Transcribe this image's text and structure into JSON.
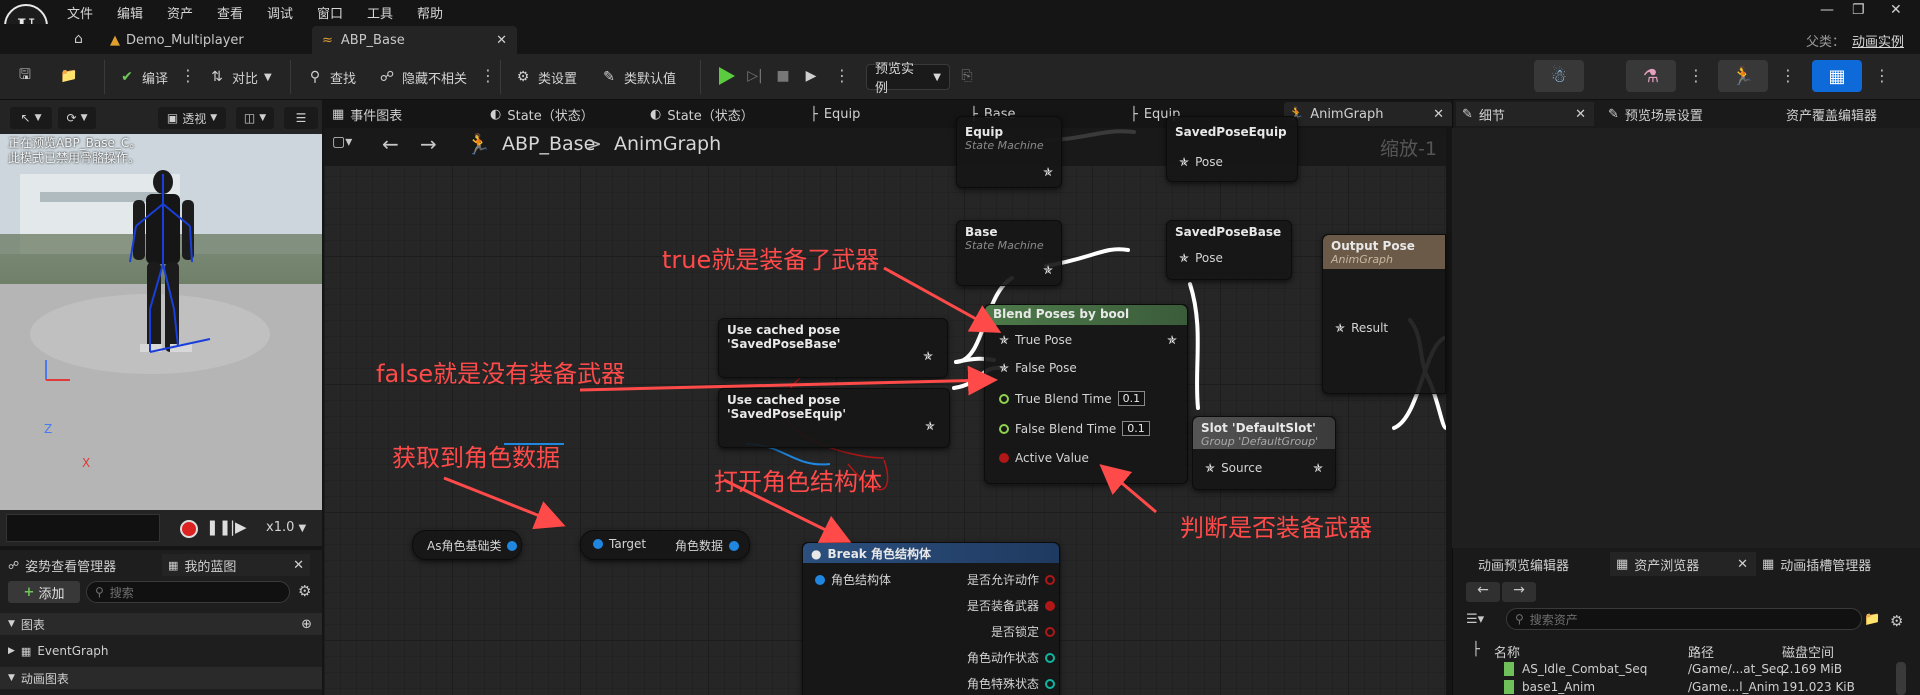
{
  "menu": {
    "items": [
      "文件",
      "编辑",
      "资产",
      "查看",
      "调试",
      "窗口",
      "工具",
      "帮助"
    ]
  },
  "tabs": {
    "project": "Demo_Multiplayer",
    "asset": "ABP_Base",
    "parent_label": "父类：",
    "parent_value": "动画实例"
  },
  "toolbar": {
    "compile": "编译",
    "diff": "对比",
    "find": "查找",
    "hide_unrelated": "隐藏不相关",
    "class_settings": "类设置",
    "class_defaults": "类默认值",
    "preview_instance": "预览实例"
  },
  "viewport": {
    "perspective": "透视",
    "message_line1": "正在预览ABP_Base_C。",
    "message_line2": "此模式已禁用骨骼操作。",
    "axis_z": "Z",
    "axis_x": "X",
    "speed": "x1.0"
  },
  "left_panel": {
    "tab_pose_watch": "姿势查看管理器",
    "tab_my_blueprint": "我的蓝图",
    "add": "添加",
    "search_placeholder": "搜索",
    "section_graphs": "图表",
    "event_graph": "EventGraph",
    "section_anim_graphs": "动画图表"
  },
  "graph_tabs": [
    {
      "label": "事件图表"
    },
    {
      "label": "State（状态）"
    },
    {
      "label": "State（状态）"
    },
    {
      "label": "Equip"
    },
    {
      "label": "Base"
    },
    {
      "label": "Equip"
    },
    {
      "label": "AnimGraph"
    }
  ],
  "graph": {
    "breadcrumb_root": "ABP_Base",
    "breadcrumb_sep": ">",
    "breadcrumb_leaf": "AnimGraph",
    "zoom": "缩放-1",
    "nodes": {
      "equip_sm_title": "Equip",
      "equip_sm_sub": "State Machine",
      "saved_pose_equip_title": "SavedPoseEquip",
      "saved_pose_equip_pin": "Pose",
      "base_sm_title": "Base",
      "base_sm_sub": "State Machine",
      "saved_pose_base_title": "SavedPoseBase",
      "saved_pose_base_pin": "Pose",
      "output_pose_title": "Output Pose",
      "output_pose_sub": "AnimGraph",
      "output_pose_pin": "Result",
      "cached_base": "Use cached pose 'SavedPoseBase'",
      "cached_equip": "Use cached pose 'SavedPoseEquip'",
      "blend_title": "Blend Poses by bool",
      "blend_true_pose": "True Pose",
      "blend_false_pose": "False Pose",
      "blend_true_time": "True Blend Time",
      "blend_true_time_val": "0.1",
      "blend_false_time": "False Blend Time",
      "blend_false_time_val": "0.1",
      "blend_active": "Active Value",
      "slot_title": "Slot 'DefaultSlot'",
      "slot_sub": "Group 'DefaultGroup'",
      "slot_pin": "Source",
      "cast_title": "As角色基础类",
      "target_pin": "Target",
      "char_data_pin": "角色数据",
      "break_title": "Break 角色结构体",
      "break_in": "角色结构体",
      "break_out1": "是否允许动作",
      "break_out2": "是否装备武器",
      "break_out3": "是否锁定",
      "break_out4": "角色动作状态",
      "break_out5": "角色特殊状态"
    }
  },
  "annotations": {
    "true_note": "true就是装备了武器",
    "false_note": "false就是没有装备武器",
    "get_data": "获取到角色数据",
    "open_struct": "打开角色结构体",
    "judge": "判断是否装备武器"
  },
  "right_panel": {
    "details": "细节",
    "preview_scene": "预览场景设置",
    "asset_override": "资产覆盖编辑器",
    "anim_preview": "动画预览编辑器",
    "asset_browser": "资产浏览器",
    "anim_slot": "动画插槽管理器",
    "search_placeholder": "搜索资产",
    "col_name": "名称",
    "col_path": "路径",
    "col_disk": "磁盘空间",
    "rows": [
      {
        "name": "AS_Idle_Combat_Seq",
        "path": "/Game/...at_Seq",
        "size": "2.169 MiB"
      },
      {
        "name": "base1_Anim",
        "path": "/Game...l_Anim",
        "size": "191.023 KiB"
      }
    ]
  },
  "colors": {
    "accent_blue": "#0e6ad8",
    "annotation_red": "#ff4a4a",
    "blend_header_green": "#4d7a4a",
    "break_header_blue": "#2b4f7e",
    "pin_bool_red": "#b01717",
    "pin_float_green": "#8fd14f",
    "pin_struct_blue": "#1f87e0"
  }
}
